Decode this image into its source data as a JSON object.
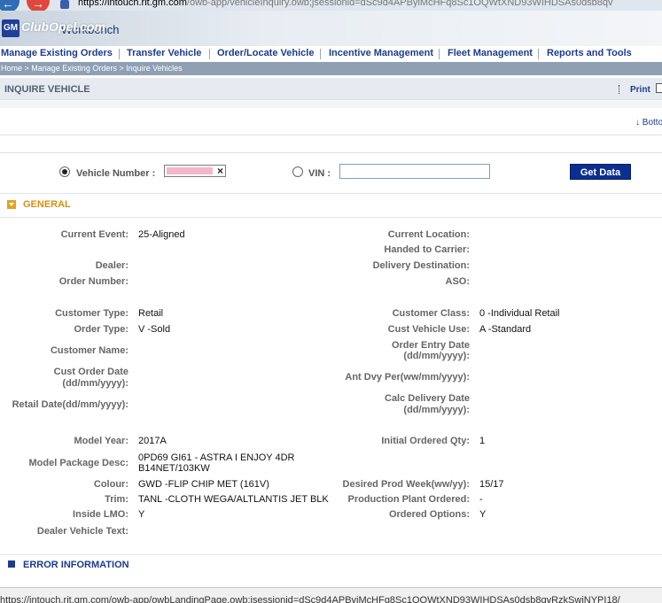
{
  "browser": {
    "url_host": "https://intouch.rit.gm.com",
    "url_rest": "/owb-app/vehicleInquiry.owb;jsessionid=dSc9d4APByiMcHFq8Sc1OQWtXND93WIHDSAs0dsb8qv",
    "status_url": "https://intouch.rit.gm.com/owb-app/owbLandingPage.owb;jsessionid=dSc9d4APByiMcHFq8Sc1OQWtXND93WIHDSAs0dsb8qyRzkSwiNYPI18/"
  },
  "header": {
    "logo": "GM",
    "title": "Workbench",
    "watermark": "ClubOpel.com"
  },
  "menu": {
    "items": [
      "Manage Existing Orders",
      "Transfer Vehicle",
      "Order/Locate Vehicle",
      "Incentive Management",
      "Fleet Management",
      "Reports and Tools"
    ]
  },
  "breadcrumb": {
    "home": "Home",
    "sep": " > ",
    "level1": "Manage Existing Orders",
    "level2": "Inquire Vehicles"
  },
  "page": {
    "title": "INQUIRE VEHICLE",
    "print_label": "Print",
    "bottom_link": "↓ Bottom"
  },
  "search": {
    "vehicle_number_label": "Vehicle Number :",
    "vin_label": "VIN :",
    "vin_value": "",
    "get_data_label": "Get Data",
    "selected": "vehicle_number"
  },
  "general": {
    "section_title": "GENERAL",
    "left": {
      "current_event": {
        "label": "Current Event:",
        "value": "25-Aligned"
      },
      "dealer": {
        "label": "Dealer:",
        "value": ""
      },
      "order_number": {
        "label": "Order Number:",
        "value": ""
      },
      "customer_type": {
        "label": "Customer Type:",
        "value": "Retail"
      },
      "order_type": {
        "label": "Order Type:",
        "value": "V -Sold"
      },
      "customer_name": {
        "label": "Customer Name:",
        "value": ""
      },
      "cust_order_date": {
        "label1": "Cust Order Date",
        "label2": "(dd/mm/yyyy):",
        "value": ""
      },
      "retail_date": {
        "label": "Retail Date(dd/mm/yyyy):",
        "value": ""
      },
      "model_year": {
        "label": "Model Year:",
        "value": "2017A"
      },
      "model_package": {
        "label": "Model Package Desc:",
        "value1": "0PD69 GI61 - ASTRA I ENJOY 4DR",
        "value2": "B14NET/103KW"
      },
      "colour": {
        "label": "Colour:",
        "value": "GWD -FLIP CHIP MET (161V)"
      },
      "trim": {
        "label": "Trim:",
        "value": "TANL -CLOTH WEGA/ALTLANTIS JET BLK"
      },
      "inside_lmo": {
        "label": "Inside LMO:",
        "value": "Y"
      },
      "dealer_vehicle_text": {
        "label": "Dealer Vehicle Text:",
        "value": ""
      }
    },
    "right": {
      "current_location": {
        "label": "Current Location:",
        "value": ""
      },
      "handed_to_carrier": {
        "label": "Handed to Carrier:",
        "value": ""
      },
      "delivery_destination": {
        "label": "Delivery Destination:",
        "value": ""
      },
      "aso": {
        "label": "ASO:",
        "value": ""
      },
      "customer_class": {
        "label": "Customer Class:",
        "value": "0 -Individual Retail"
      },
      "cust_vehicle_use": {
        "label": "Cust Vehicle Use:",
        "value": "A -Standard"
      },
      "order_entry_date": {
        "label1": "Order Entry Date",
        "label2": "(dd/mm/yyyy):",
        "value": ""
      },
      "ant_dvy_per": {
        "label": "Ant Dvy Per(ww/mm/yyyy):",
        "value": ""
      },
      "calc_delivery_date": {
        "label1": "Calc Delivery Date",
        "label2": "(dd/mm/yyyy):",
        "value": ""
      },
      "initial_ordered_qty": {
        "label": "Initial Ordered Qty:",
        "value": "1"
      },
      "desired_prod_week": {
        "label": "Desired Prod Week(ww/yy):",
        "value": "15/17"
      },
      "production_plant_ordered": {
        "label": "Production Plant Ordered:",
        "value": "-"
      },
      "ordered_options": {
        "label": "Ordered Options:",
        "value": "Y"
      }
    }
  },
  "error_section": {
    "title": "ERROR INFORMATION"
  }
}
